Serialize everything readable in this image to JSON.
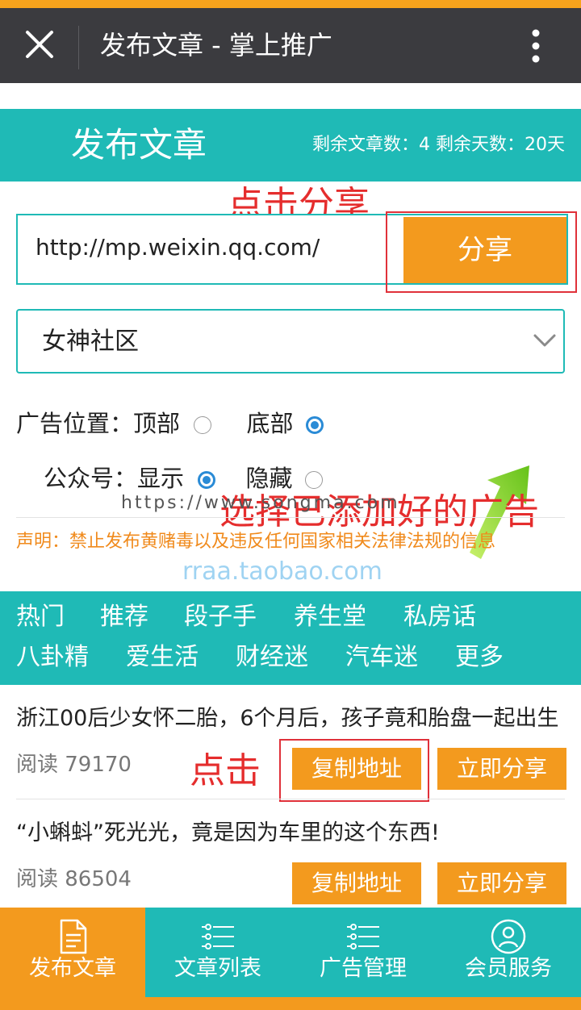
{
  "window": {
    "title": "发布文章 - 掌上推广"
  },
  "header": {
    "title": "发布文章",
    "stats": "剩余文章数：4  剩余天数：20天"
  },
  "share_form": {
    "url_value": "http://mp.weixin.qq.com/",
    "share_label": "分享"
  },
  "ad_select": {
    "selected": "女神社区"
  },
  "options": {
    "ad_position_label": "广告位置：",
    "top_label": "顶部",
    "bottom_label": "底部",
    "ad_position_selected": "底部",
    "account_label": "公众号：",
    "show_label": "显示",
    "hide_label": "隐藏",
    "account_selected": "显示"
  },
  "notice": "声明：禁止发布黄赌毒以及违反任何国家相关法律法规的信息",
  "watermarks": {
    "songma": "https://www.songma.com",
    "taobao": "rraa.taobao.com"
  },
  "annotations": {
    "click_share": "点击分享",
    "select_ad": "选择已添加好的广告",
    "click": "点击"
  },
  "categories": [
    "热门",
    "推荐",
    "段子手",
    "养生堂",
    "私房话",
    "八卦精",
    "爱生活",
    "财经迷",
    "汽车迷",
    "更多"
  ],
  "articles": [
    {
      "title": "浙江00后少女怀二胎，6个月后，孩子竟和胎盘一起出生",
      "reads": "阅读 79170",
      "copy_label": "复制地址",
      "share_label": "立即分享"
    },
    {
      "title": "“小蝌蚪”死光光，竟是因为车里的这个东西!",
      "reads": "阅读 86504",
      "copy_label": "复制地址",
      "share_label": "立即分享"
    }
  ],
  "tabs": [
    {
      "label": "发布文章",
      "icon": "document-icon",
      "active": true
    },
    {
      "label": "文章列表",
      "icon": "list-icon",
      "active": false
    },
    {
      "label": "广告管理",
      "icon": "list-icon",
      "active": false
    },
    {
      "label": "会员服务",
      "icon": "user-icon",
      "active": false
    }
  ],
  "colors": {
    "teal": "#1fbab6",
    "orange": "#f39a1e",
    "annotation_red": "#e52d2d",
    "titlebar": "#3b3b3f"
  }
}
